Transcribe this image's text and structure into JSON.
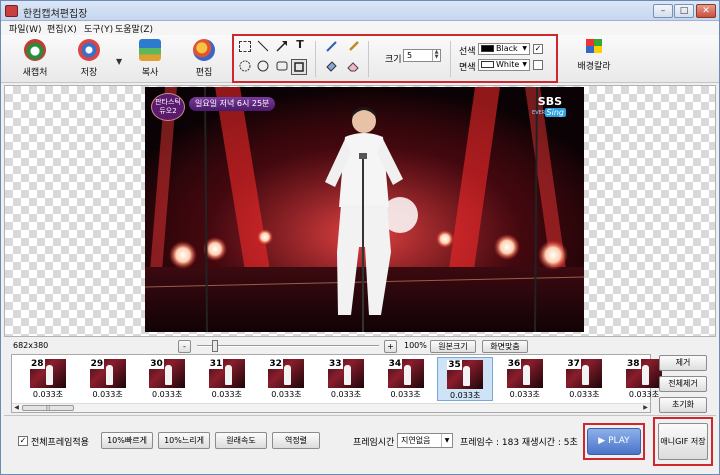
{
  "window": {
    "title": "한컴캡쳐편집장",
    "minimize": "–",
    "maximize": "□",
    "close": "✕"
  },
  "menu": [
    "파일(W)",
    "편집(X)",
    "도구(Y)",
    "도움말(Z)"
  ],
  "toolbar": {
    "new_capture": "새캡처",
    "save": "저장",
    "save_dropdown": "▼",
    "copy": "복사",
    "edit": "편집",
    "bg_color": "배경칼라"
  },
  "drawing": {
    "text_tool": "T",
    "size_label": "크기",
    "size_value": "5",
    "line_color_label": "선색",
    "line_color_value": "Black",
    "fill_color_label": "면색",
    "fill_color_value": "White",
    "line_color_enabled": true,
    "fill_color_enabled": false,
    "colors": {
      "line": "#000000",
      "fill": "#ffffff"
    }
  },
  "canvas": {
    "badge_line1": "판타스틱",
    "badge_line2": "듀오2",
    "caption": "일요일 저녁 6시 25분",
    "channel": "SBS",
    "channel_sub": "EVERY",
    "channel_tag": "Sing"
  },
  "status": {
    "dimensions": "682x380",
    "zoom_minus": "-",
    "zoom_plus": "+",
    "zoom_percent": "100%",
    "zoom_level": 0.1,
    "original_size": "원본크기",
    "fit_screen": "화면맞춤"
  },
  "frames": [
    {
      "number": "28",
      "duration": "0.033초",
      "selected": false
    },
    {
      "number": "29",
      "duration": "0.033초",
      "selected": false
    },
    {
      "number": "30",
      "duration": "0.033초",
      "selected": false
    },
    {
      "number": "31",
      "duration": "0.033초",
      "selected": false
    },
    {
      "number": "32",
      "duration": "0.033초",
      "selected": false
    },
    {
      "number": "33",
      "duration": "0.033초",
      "selected": false
    },
    {
      "number": "34",
      "duration": "0.033초",
      "selected": false
    },
    {
      "number": "35",
      "duration": "0.033초",
      "selected": true
    },
    {
      "number": "36",
      "duration": "0.033초",
      "selected": false
    },
    {
      "number": "37",
      "duration": "0.033초",
      "selected": false
    },
    {
      "number": "38",
      "duration": "0.033초",
      "selected": false
    }
  ],
  "scroll": {
    "left": "◀",
    "right": "▶",
    "grip": "|||"
  },
  "side_buttons": {
    "remove": "제거",
    "remove_all": "전체제거",
    "reset": "초기화"
  },
  "bottom": {
    "apply_all_checked": true,
    "apply_all_label": "전체프레임적용",
    "faster": "10%빠르게",
    "slower": "10%느리게",
    "original_speed": "원래속도",
    "reverse": "역정렬",
    "frame_time_label": "프레임시간",
    "frame_time_value": "지연없음",
    "frame_count_text": "프레임수 : 183  재생시간 : 5초",
    "play": "▶ PLAY",
    "save_gif": "애니GIF 저장"
  }
}
